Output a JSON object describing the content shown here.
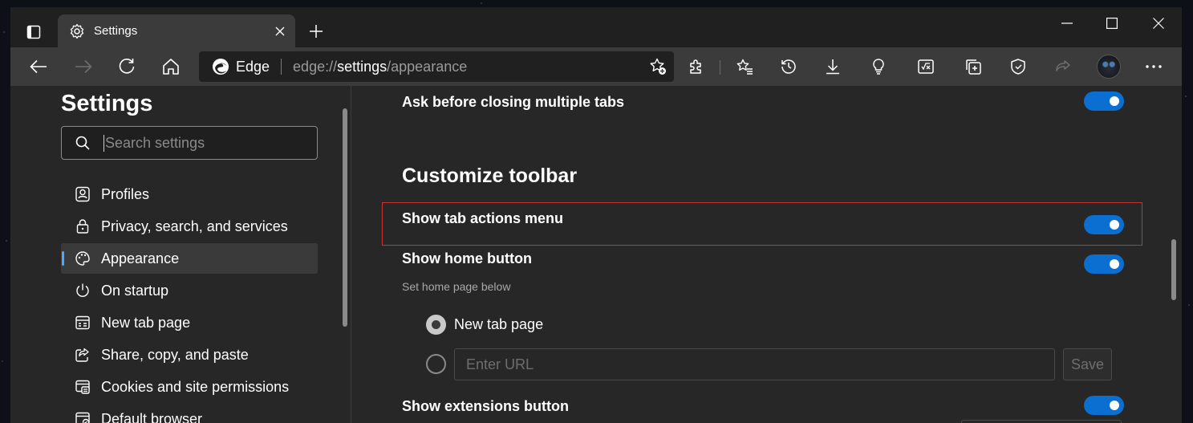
{
  "tab": {
    "title": "Settings"
  },
  "address": {
    "label": "Edge",
    "url_prefix": "edge://",
    "url_main": "settings",
    "url_suffix": "/appearance"
  },
  "sidebar": {
    "title": "Settings",
    "search_placeholder": "Search settings",
    "items": [
      {
        "label": "Profiles",
        "icon": "profile-icon"
      },
      {
        "label": "Privacy, search, and services",
        "icon": "lock-icon"
      },
      {
        "label": "Appearance",
        "icon": "palette-icon",
        "active": true
      },
      {
        "label": "On startup",
        "icon": "power-icon"
      },
      {
        "label": "New tab page",
        "icon": "newtab-page-icon"
      },
      {
        "label": "Share, copy, and paste",
        "icon": "share-icon"
      },
      {
        "label": "Cookies and site permissions",
        "icon": "cookies-icon"
      },
      {
        "label": "Default browser",
        "icon": "default-browser-icon"
      }
    ]
  },
  "main": {
    "ask_before_closing": "Ask before closing multiple tabs",
    "section_title": "Customize toolbar",
    "show_tab_actions": "Show tab actions menu",
    "show_home_button": "Show home button",
    "set_home_page_below": "Set home page below",
    "radio_new_tab": "New tab page",
    "url_placeholder": "Enter URL",
    "save_label": "Save",
    "show_extensions_button": "Show extensions button"
  },
  "colors": {
    "accent": "#0a6fd1",
    "highlight": "#c8323a",
    "active_indicator": "#4ea8ff"
  }
}
